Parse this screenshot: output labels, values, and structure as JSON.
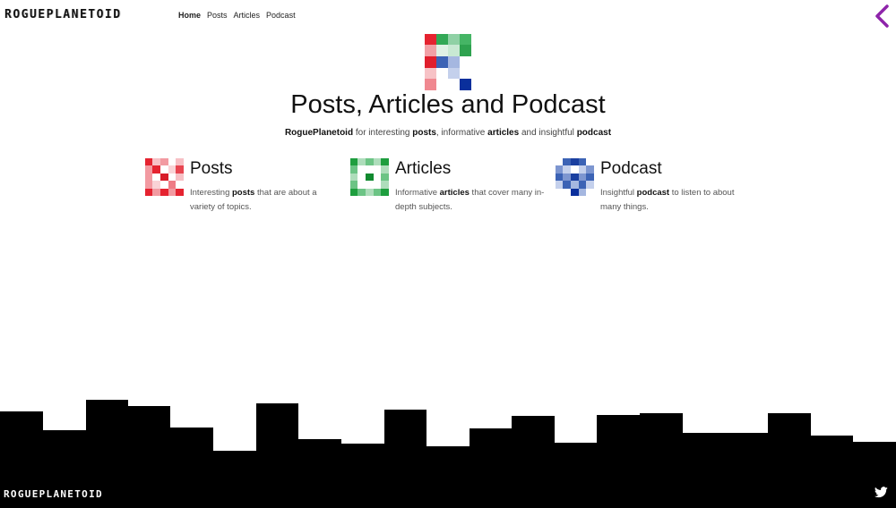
{
  "header": {
    "logo_text": "ROGUEPLANETOID",
    "nav": [
      {
        "label": "Home",
        "active": true
      },
      {
        "label": "Posts",
        "active": false
      },
      {
        "label": "Articles",
        "active": false
      },
      {
        "label": "Podcast",
        "active": false
      }
    ],
    "back_icon": "chevron-left-icon",
    "back_color": "#8e24aa"
  },
  "hero": {
    "title": "Posts, Articles and Podcast",
    "subtitle": {
      "brand": "RoguePlanetoid",
      "t1": " for interesting ",
      "k1": "posts",
      "t2": ", informative ",
      "k2": "articles",
      "t3": " and insightful ",
      "k3": "podcast"
    }
  },
  "features": [
    {
      "title": "Posts",
      "pre": "Interesting ",
      "keyword": "posts",
      "post": " that are about a variety of topics.",
      "icon": "posts-icon",
      "color": "#e02030"
    },
    {
      "title": "Articles",
      "pre": "Informative ",
      "keyword": "articles",
      "post": " that cover many in-depth subjects.",
      "icon": "articles-icon",
      "color": "#1e9e3e"
    },
    {
      "title": "Podcast",
      "pre": "Insightful ",
      "keyword": "podcast",
      "post": " to listen to about many things.",
      "icon": "podcast-icon",
      "color": "#1a3fa0"
    }
  ],
  "footer": {
    "logo_text": "ROGUEPLANETOID",
    "social_icon": "twitter-icon"
  }
}
